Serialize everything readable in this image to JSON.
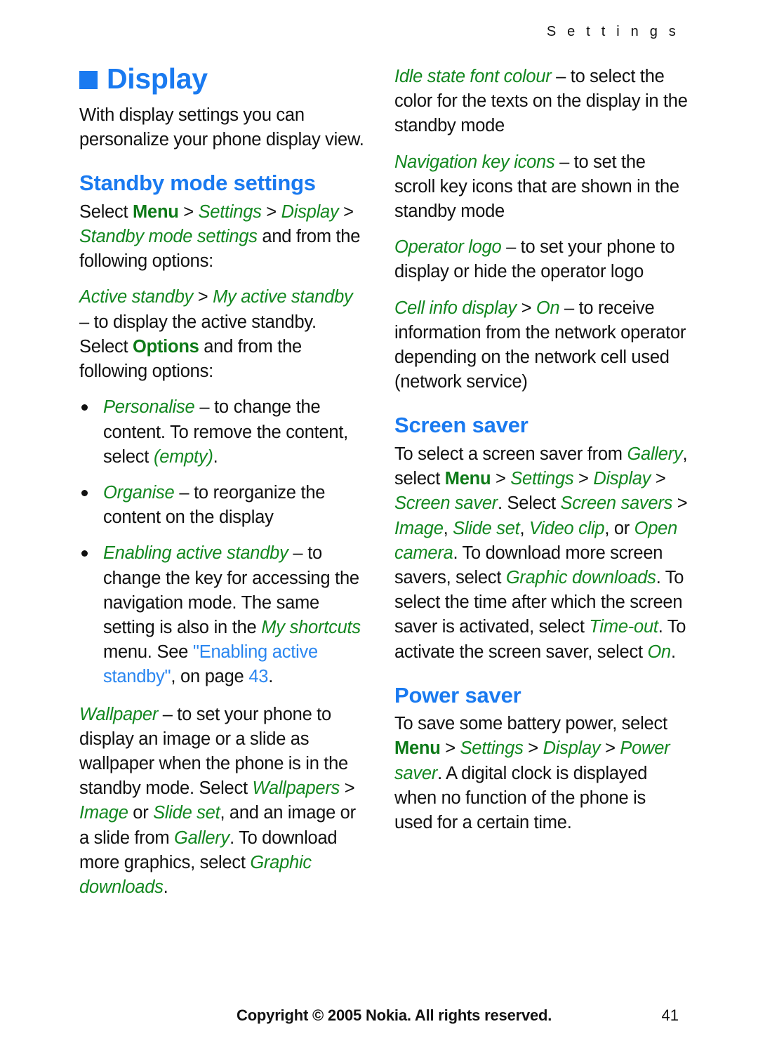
{
  "running_head": "S e t t i n g s",
  "colors": {
    "heading_blue": "#1a7af0",
    "ui_green": "#12871f",
    "link_blue": "#2a86f0",
    "body_black": "#101010"
  },
  "left_column": {
    "chapter_title": "Display",
    "intro": "With display settings you can personalize your phone display view.",
    "section_title": "Standby mode settings",
    "select_path": {
      "lead": "Select ",
      "menu": "Menu",
      "sep": " > ",
      "settings": "Settings",
      "display": "Display",
      "standby_mode_settings": "Standby mode settings",
      "tail": " and from the following options:"
    },
    "active_standby": {
      "term1": "Active standby",
      "sep": " > ",
      "term2": "My active standby",
      "desc_a": " – to display the active standby. Select ",
      "options_key": "Options",
      "desc_b": " and from the following options:"
    },
    "bullets": [
      {
        "term": "Personalise",
        "text_a": " – to change the content. To remove the content, select ",
        "term2": "(empty)",
        "text_b": "."
      },
      {
        "term": "Organise",
        "text_a": " – to reorganize the content on the display",
        "term2": "",
        "text_b": ""
      },
      {
        "term": "Enabling active standby",
        "text_a": " – to change the key for accessing the navigation mode. The same setting is also in the ",
        "term2": "My shortcuts",
        "text_b": " menu. See ",
        "link": "\"Enabling active standby\"",
        "text_c": ", on page ",
        "page_ref": "43",
        "text_d": "."
      }
    ],
    "wallpaper": {
      "term": "Wallpaper",
      "text_a": " – to set your phone to display an image or a slide as wallpaper when the phone is in the standby mode. Select ",
      "term_wallpapers": "Wallpapers",
      "sep": " > ",
      "term_image": "Image",
      "text_or": " or ",
      "term_slideset": "Slide set",
      "text_b": ", and an image or a slide from ",
      "term_gallery": "Gallery",
      "text_c": ". To download more graphics, select ",
      "term_graphic_downloads": "Graphic downloads",
      "text_d": "."
    }
  },
  "right_column": {
    "idle_state": {
      "term": "Idle state font colour",
      "text": " – to select the color for the texts on the display in the standby mode"
    },
    "navigation_key_icons": {
      "term": "Navigation key icons",
      "text": " – to set the scroll key icons that are shown in the standby mode"
    },
    "operator_logo": {
      "term": "Operator logo",
      "text": " – to set your phone to display or hide the operator logo"
    },
    "cell_info": {
      "term": "Cell info display",
      "sep": " > ",
      "term2": "On",
      "text": " – to receive information from the network operator depending on the network cell used (network service)"
    },
    "screen_saver": {
      "title": "Screen saver",
      "text_a": "To select a screen saver from ",
      "term_gallery": "Gallery",
      "text_b": ", select ",
      "menu": "Menu",
      "sep": " > ",
      "term_settings": "Settings",
      "term_display": "Display",
      "term_screen_saver": "Screen saver",
      "text_c": ". Select ",
      "term_screen_savers": "Screen savers",
      "text_d": " > ",
      "term_image": "Image",
      "comma1": ", ",
      "term_slideset": "Slide set",
      "comma2": ", ",
      "term_videoclip": "Video clip",
      "text_or": ", or ",
      "term_opencamera": "Open camera",
      "text_e": ". To download more screen savers, select ",
      "term_graphic_downloads": "Graphic downloads",
      "text_f": ". To select the time after which the screen saver is activated, select ",
      "term_timeout": "Time-out",
      "text_g": ". To activate the screen saver, select ",
      "term_on": "On",
      "text_h": "."
    },
    "power_saver": {
      "title": "Power saver",
      "text_a": "To save some battery power, select ",
      "menu": "Menu",
      "sep": " > ",
      "term_settings": "Settings",
      "term_display": "Display",
      "term_power_saver": "Power saver",
      "text_b": ". A digital clock is displayed when no function of the phone is used for a certain time."
    }
  },
  "footer": {
    "copyright": "Copyright © 2005 Nokia. All rights reserved.",
    "page_number": "41"
  }
}
